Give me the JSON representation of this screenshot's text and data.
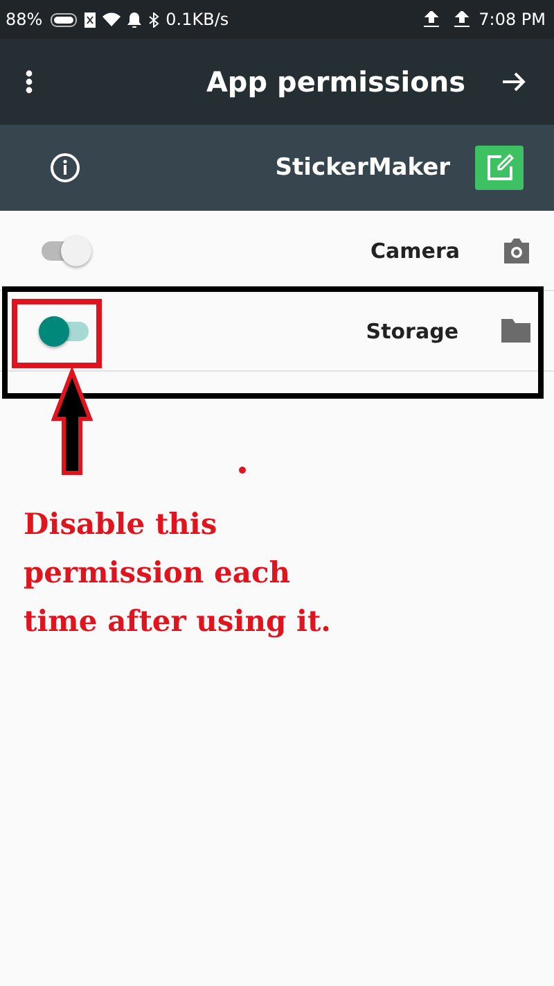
{
  "status_bar": {
    "battery": "88%",
    "speed": "0.1KB/s",
    "time": "7:08 PM"
  },
  "app_bar": {
    "title": "App permissions"
  },
  "app_header": {
    "name": "StickerMaker"
  },
  "permissions": [
    {
      "name": "Camera",
      "on": false,
      "kind": "camera"
    },
    {
      "name": "Storage",
      "on": true,
      "kind": "folder"
    }
  ],
  "annotation": {
    "text": "Disable this permission each time after using it."
  }
}
